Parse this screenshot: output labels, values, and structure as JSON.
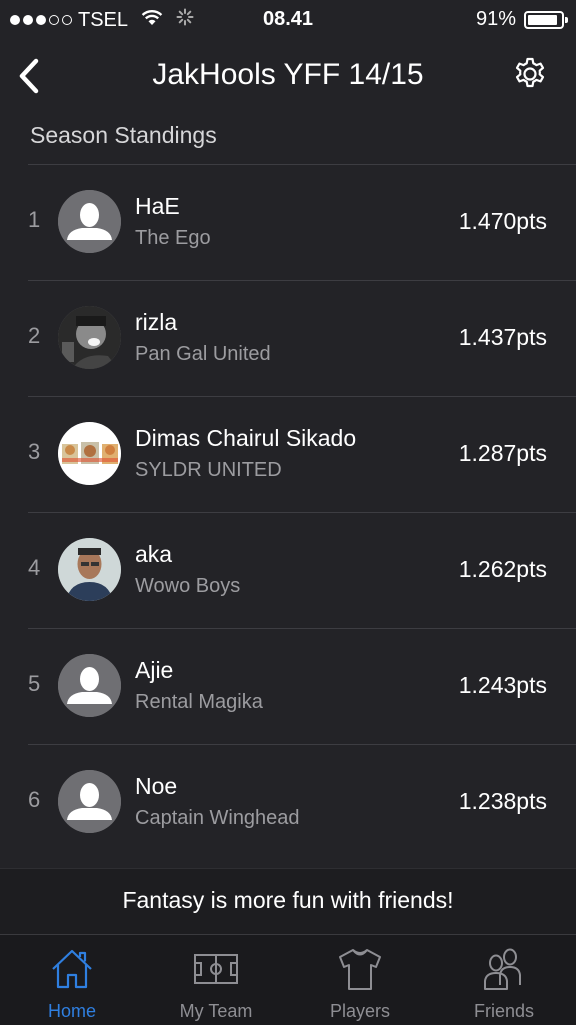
{
  "status_bar": {
    "carrier": "TSEL",
    "time": "08.41",
    "battery_percent": "91%",
    "battery_level": 0.91,
    "signal_bars_filled": 3,
    "signal_bars_total": 5
  },
  "header": {
    "title": "JakHools YFF 14/15",
    "back_icon": "chevron-left-icon",
    "settings_icon": "gear-icon"
  },
  "section": {
    "title": "Season Standings"
  },
  "standings": [
    {
      "rank": "1",
      "name": "HaE",
      "team": "The Ego",
      "points": "1.470pts",
      "avatar": "default-avatar-icon"
    },
    {
      "rank": "2",
      "name": "rizla",
      "team": "Pan Gal United",
      "points": "1.437pts",
      "avatar": "photo-avatar"
    },
    {
      "rank": "3",
      "name": "Dimas Chairul Sikado",
      "team": "SYLDR UNITED",
      "points": "1.287pts",
      "avatar": "photo-avatar"
    },
    {
      "rank": "4",
      "name": "aka",
      "team": "Wowo Boys",
      "points": "1.262pts",
      "avatar": "photo-avatar"
    },
    {
      "rank": "5",
      "name": "Ajie",
      "team": "Rental Magika",
      "points": "1.243pts",
      "avatar": "default-avatar-icon"
    },
    {
      "rank": "6",
      "name": "Noe",
      "team": "Captain Winghead",
      "points": "1.238pts",
      "avatar": "default-avatar-icon"
    }
  ],
  "banner": {
    "text": "Fantasy is more fun with friends!"
  },
  "tabbar": {
    "accent_color": "#2f7fe0",
    "tabs": [
      {
        "label": "Home",
        "icon": "home-icon",
        "active": true
      },
      {
        "label": "My Team",
        "icon": "pitch-icon",
        "active": false
      },
      {
        "label": "Players",
        "icon": "jersey-icon",
        "active": false
      },
      {
        "label": "Friends",
        "icon": "friends-icon",
        "active": false
      }
    ]
  }
}
